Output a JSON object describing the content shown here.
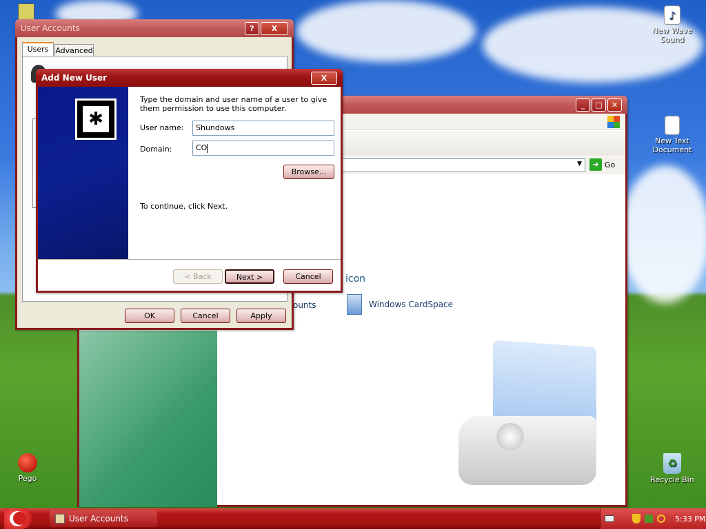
{
  "desktop": {
    "icons": [
      {
        "label": "New Wave Sound",
        "icon": "wav-file-icon"
      },
      {
        "label": "New Text Document",
        "icon": "text-file-icon"
      },
      {
        "label": "Recycle Bin",
        "icon": "recycle-bin-icon"
      },
      {
        "label": "Pego",
        "icon": "pego-shortcut-icon"
      }
    ]
  },
  "control_panel": {
    "go_label": "Go",
    "items": [
      {
        "label": "Windows CardSpace"
      },
      {
        "label": "ounts"
      },
      {
        "label": "icon"
      }
    ]
  },
  "user_accounts": {
    "title": "User Accounts",
    "help_btn": "?",
    "close_btn": "X",
    "tabs": [
      {
        "label": "Users"
      },
      {
        "label": "Advanced"
      }
    ],
    "ok": "OK",
    "cancel": "Cancel",
    "apply": "Apply"
  },
  "add_user": {
    "title": "Add New User",
    "close_btn": "X",
    "instructions": "Type the domain and user name of a user to give them permission to use this computer.",
    "username_label": "User name:",
    "username_value": "Shundows",
    "domain_label": "Domain:",
    "domain_value": "CO",
    "browse": "Browse...",
    "continue_text": "To continue, click Next.",
    "back": "< Back",
    "next": "Next >",
    "cancel": "Cancel"
  },
  "taskbar": {
    "task_label": "User Accounts",
    "clock": "5:33 PM"
  }
}
